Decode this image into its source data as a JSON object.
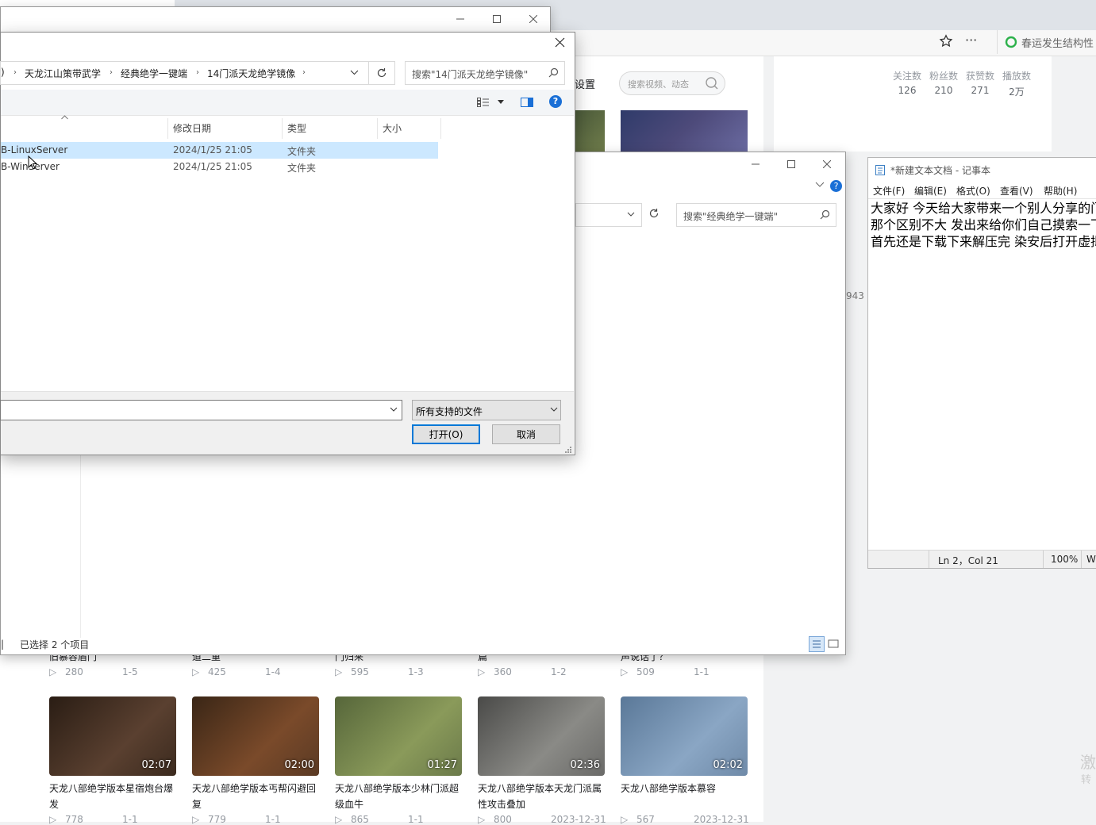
{
  "browser": {
    "news_ticker": "春运发生结构性",
    "page_settings": "设置",
    "search_placeholder": "搜索视频、动态",
    "stats": [
      {
        "label": "关注数",
        "value": "126"
      },
      {
        "label": "粉丝数",
        "value": "210"
      },
      {
        "label": "获赞数",
        "value": "271"
      },
      {
        "label": "播放数",
        "value": "2万"
      }
    ],
    "partial_count": "943",
    "side_text_1": "激",
    "side_text_2": "转",
    "row1": [
      {
        "title_tail": "旧慕容盾门",
        "views": "280",
        "date": "1-5"
      },
      {
        "title_tail": "道二重",
        "views": "425",
        "date": "1-4"
      },
      {
        "title_tail": "门归来",
        "views": "595",
        "date": "1-3"
      },
      {
        "title_tail": "篇",
        "views": "360",
        "date": "1-2"
      },
      {
        "title_tail": "声说话了？",
        "views": "509",
        "date": "1-1"
      }
    ],
    "row2": [
      {
        "duration": "02:07",
        "title": "天龙八部绝学版本星宿炮台爆发",
        "views": "778",
        "date": "1-1",
        "color": "#3b2a1e"
      },
      {
        "duration": "02:00",
        "title": "天龙八部绝学版本丐帮闪避回复",
        "views": "779",
        "date": "1-1",
        "color": "#5a3a24"
      },
      {
        "duration": "01:27",
        "title": "天龙八部绝学版本少林门派超级血牛",
        "views": "865",
        "date": "1-1",
        "color": "#6b7a4a"
      },
      {
        "duration": "02:36",
        "title": "天龙八部绝学版本天龙门派属性攻击叠加",
        "views": "800",
        "date": "2023-12-31",
        "color": "#6a6a68"
      },
      {
        "duration": "02:02",
        "title": "天龙八部绝学版本慕容",
        "views": "567",
        "date": "2023-12-31",
        "color": "#6f8aa8"
      }
    ]
  },
  "explorer": {
    "search_placeholder": "搜索\"经典绝学一键端\"",
    "status": "已选择 2 个项目"
  },
  "dialog": {
    "breadcrumb": [
      "天龙江山策带武学",
      "经典绝学一键端",
      "14门派天龙绝学镜像"
    ],
    "breadcrumb_lead": ")",
    "search_placeholder": "搜索\"14门派天龙绝学镜像\"",
    "columns": {
      "date": "修改日期",
      "type": "类型",
      "size": "大小"
    },
    "files": [
      {
        "name": "B-LinuxServer",
        "date": "2024/1/25 21:05",
        "type": "文件夹",
        "selected": true
      },
      {
        "name": "B-WinServer",
        "date": "2024/1/25 21:05",
        "type": "文件夹",
        "selected": false
      }
    ],
    "filter": "所有支持的文件",
    "open_btn": "打开(O)",
    "cancel_btn": "取消"
  },
  "notepad": {
    "title": "*新建文本文档 - 记事本",
    "menu": [
      "文件(F)",
      "编辑(E)",
      "格式(O)",
      "查看(V)",
      "帮助(H)"
    ],
    "lines": [
      "大家好 今天给大家带来一个别人分享的门",
      "那个区别不大 发出来给你们自己摸索一下",
      "首先还是下载下来解压完 染安后打开虚拟"
    ],
    "status_pos": "Ln 2，Col 21",
    "zoom": "100%",
    "encoding_partial": "W"
  }
}
